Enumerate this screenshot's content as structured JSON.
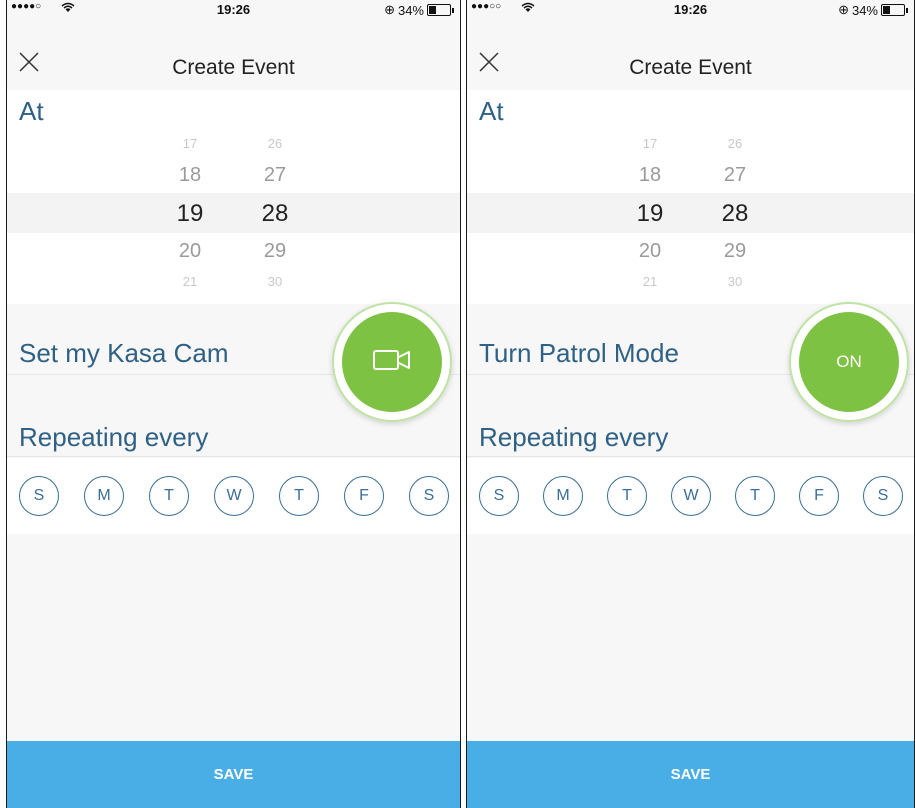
{
  "screens": [
    {
      "status": {
        "signal": "●●●●○",
        "time": "19:26",
        "battery": "34%"
      },
      "nav": {
        "title": "Create Event"
      },
      "at": {
        "label": "At",
        "hours": [
          "17",
          "18",
          "19",
          "20",
          "21"
        ],
        "minutes": [
          "26",
          "27",
          "28",
          "29",
          "30"
        ]
      },
      "action": {
        "label": "Set my Kasa Cam",
        "fab_icon": "video-camera-icon",
        "fab_text": ""
      },
      "repeat": {
        "label": "Repeating every",
        "days": [
          "S",
          "M",
          "T",
          "W",
          "T",
          "F",
          "S"
        ]
      },
      "save": "SAVE"
    },
    {
      "status": {
        "signal": "●●●○○",
        "time": "19:26",
        "battery": "34%"
      },
      "nav": {
        "title": "Create Event"
      },
      "at": {
        "label": "At",
        "hours": [
          "17",
          "18",
          "19",
          "20",
          "21"
        ],
        "minutes": [
          "26",
          "27",
          "28",
          "29",
          "30"
        ]
      },
      "action": {
        "label": "Turn Patrol Mode",
        "fab_icon": "",
        "fab_text": "ON"
      },
      "repeat": {
        "label": "Repeating every",
        "days": [
          "S",
          "M",
          "T",
          "W",
          "T",
          "F",
          "S"
        ]
      },
      "save": "SAVE"
    }
  ],
  "colors": {
    "accent": "#4aaee6",
    "fab": "#7dc242",
    "label": "#2f6185",
    "day": "#3b6f95"
  }
}
